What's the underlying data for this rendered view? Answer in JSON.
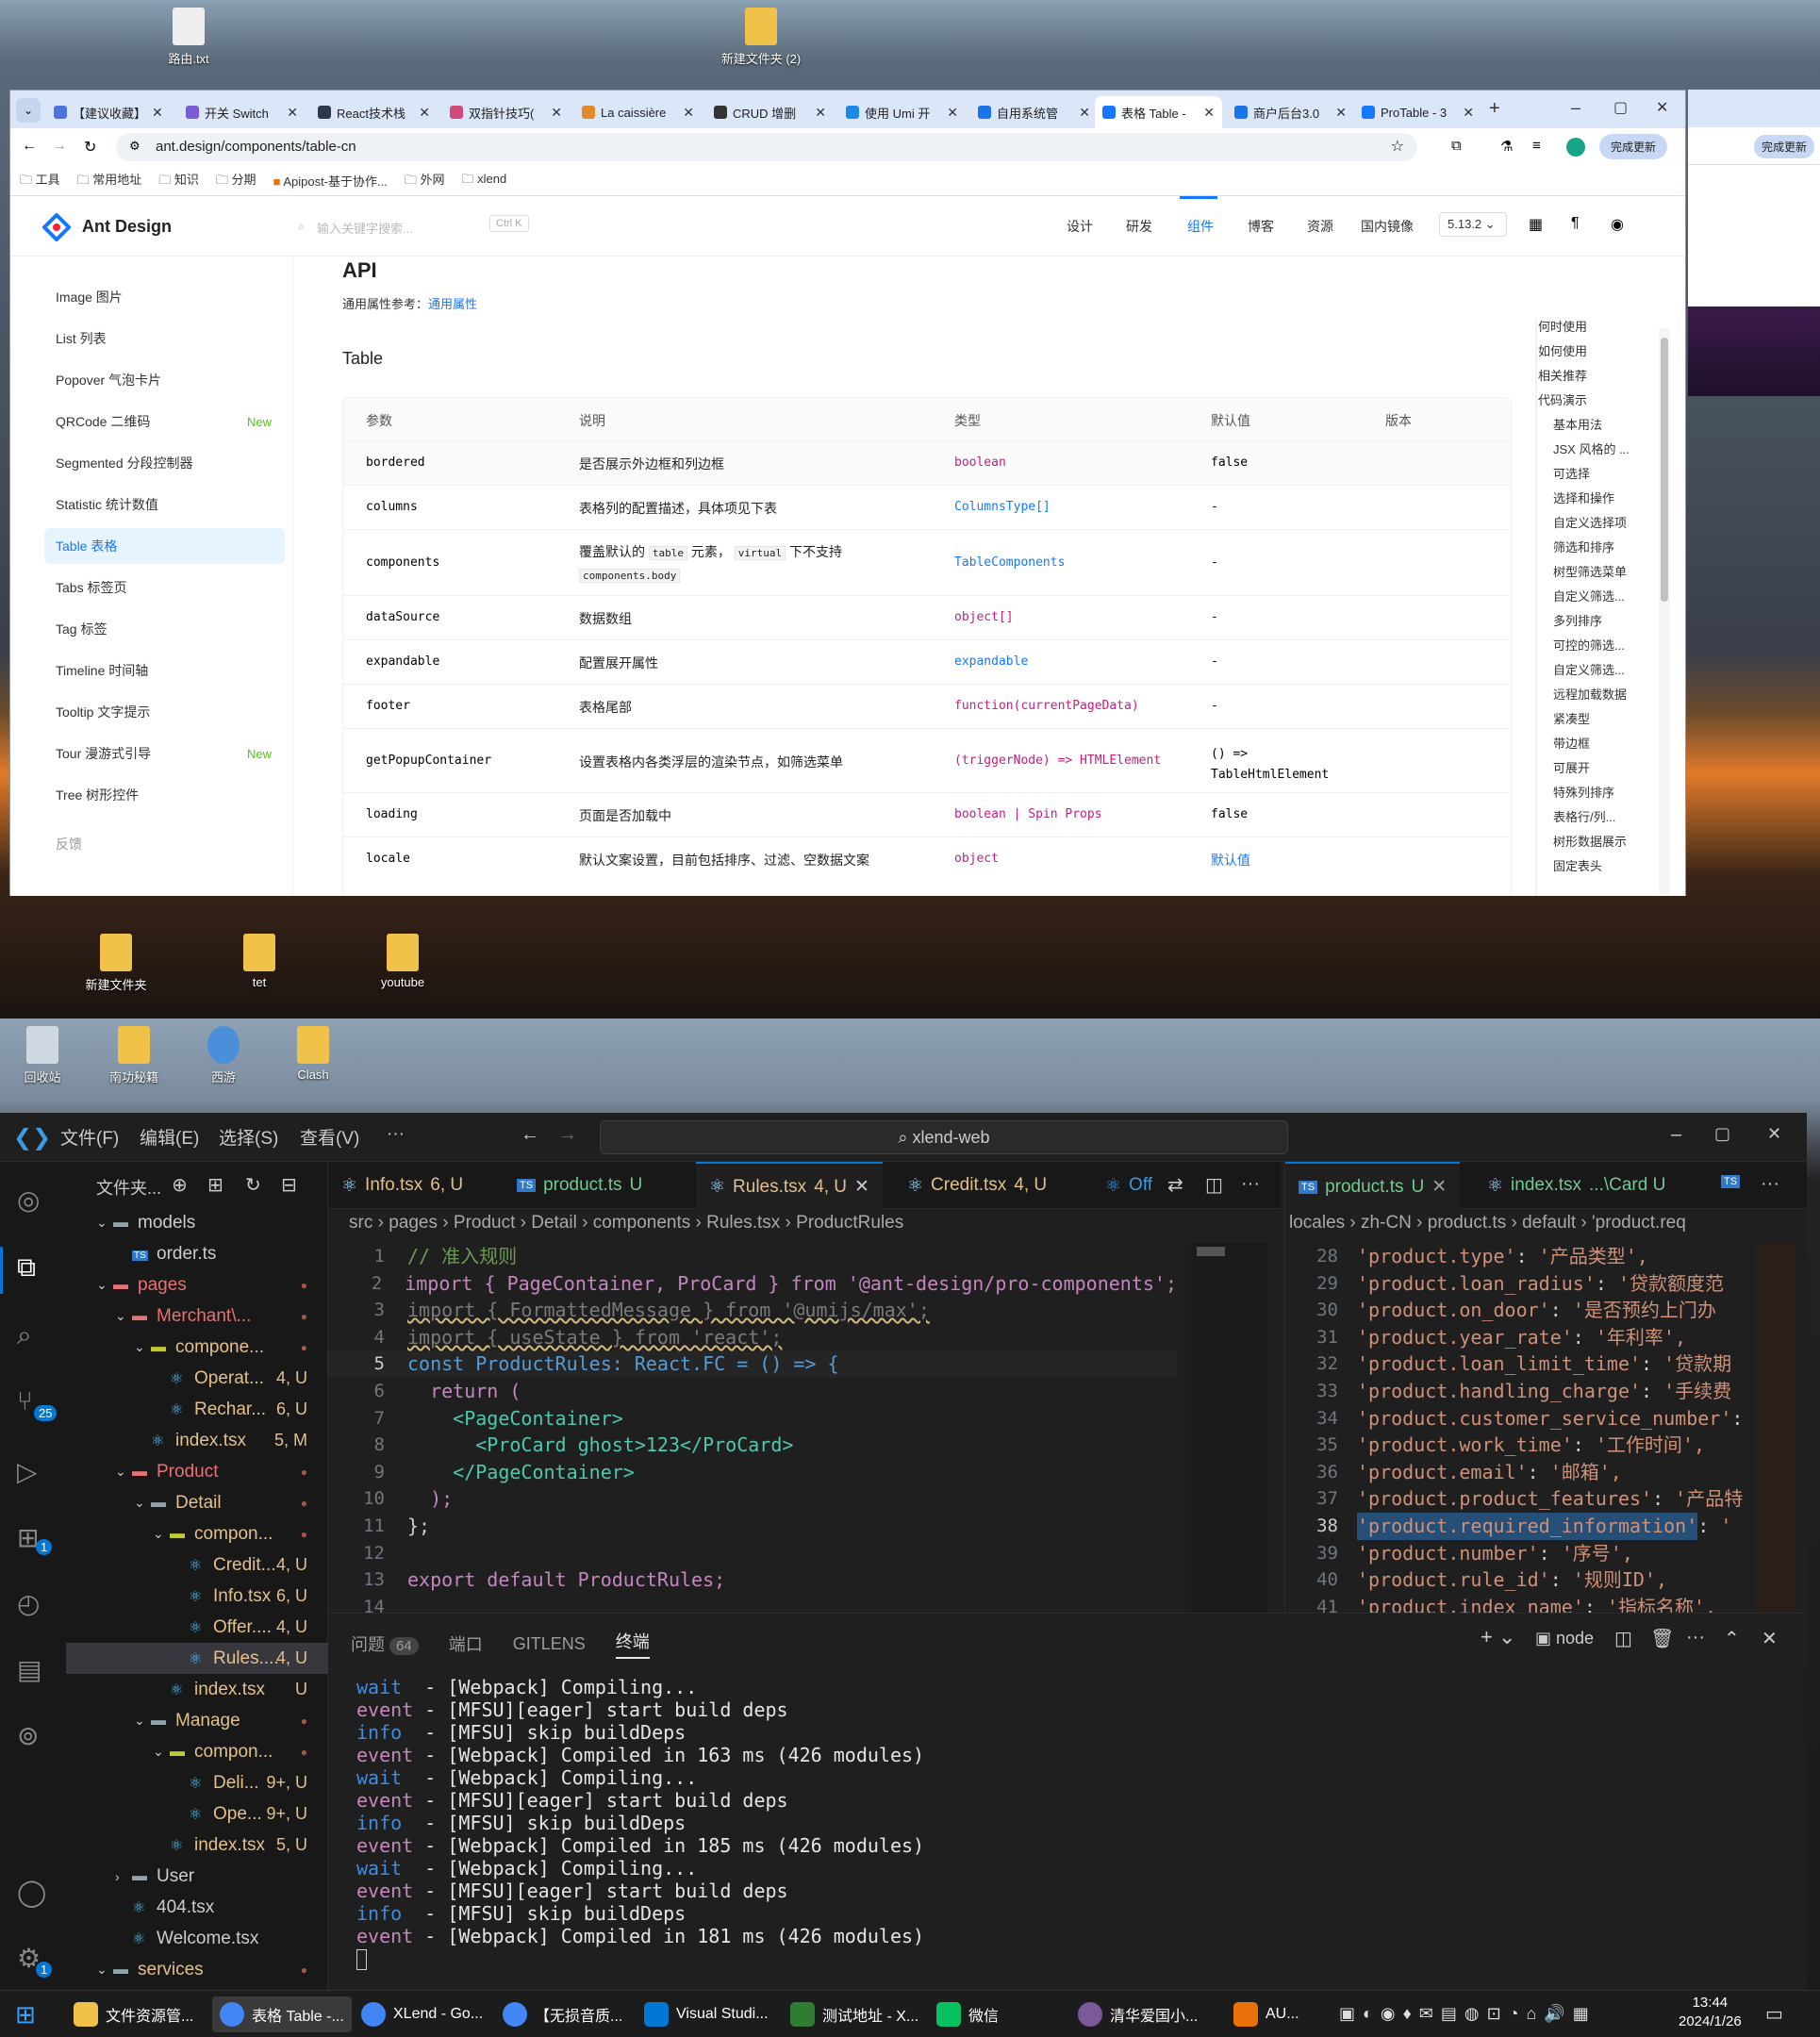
{
  "desktop_top": {
    "icons": [
      {
        "label": "路由.txt"
      },
      {
        "label": "新建文件夹 (2)"
      }
    ],
    "icons_lower": [
      {
        "label": "新建文件夹"
      },
      {
        "label": "tet"
      },
      {
        "label": "youtube"
      }
    ]
  },
  "desktop_bottom": {
    "icons": [
      {
        "label": "回收站"
      },
      {
        "label": "南功秘籍"
      },
      {
        "label": "西游"
      },
      {
        "label": "Clash"
      }
    ]
  },
  "browser": {
    "tabs": [
      {
        "label": "【建议收藏】"
      },
      {
        "label": "开关 Switch"
      },
      {
        "label": "React技术栈"
      },
      {
        "label": "双指针技巧("
      },
      {
        "label": "La caissière"
      },
      {
        "label": "CRUD 增删"
      },
      {
        "label": "使用 Umi 开"
      },
      {
        "label": "自用系统管"
      },
      {
        "label": "表格 Table -"
      },
      {
        "label": "商户后台3.0"
      },
      {
        "label": "ProTable - 3"
      }
    ],
    "url": "ant.design/components/table-cn",
    "update_button": "完成更新",
    "bookmarks": [
      "工具",
      "常用地址",
      "知识",
      "分期",
      "Apipost-基于协作...",
      "外网",
      "xlend"
    ]
  },
  "antd": {
    "logo": "Ant Design",
    "search_placeholder": "输入关键字搜索...",
    "search_shortcut": "Ctrl K",
    "nav": [
      "设计",
      "研发",
      "组件",
      "博客",
      "资源",
      "国内镜像"
    ],
    "version": "5.13.2",
    "sidebar": [
      {
        "label": "Image 图片"
      },
      {
        "label": "List 列表"
      },
      {
        "label": "Popover 气泡卡片"
      },
      {
        "label": "QRCode 二维码",
        "badge": "New"
      },
      {
        "label": "Segmented 分段控制器"
      },
      {
        "label": "Statistic 统计数值"
      },
      {
        "label": "Table 表格"
      },
      {
        "label": "Tabs 标签页"
      },
      {
        "label": "Tag 标签"
      },
      {
        "label": "Timeline 时间轴"
      },
      {
        "label": "Tooltip 文字提示"
      },
      {
        "label": "Tour 漫游式引导",
        "badge": "New"
      },
      {
        "label": "Tree 树形控件"
      },
      {
        "label": "反馈"
      }
    ],
    "api_title": "API",
    "common_props_label": "通用属性参考：",
    "common_props_link": "通用属性",
    "table_title": "Table",
    "columns": [
      "参数",
      "说明",
      "类型",
      "默认值",
      "版本"
    ],
    "rows": [
      {
        "param": "bordered",
        "desc": "是否展示外边框和列边框",
        "type": "boolean",
        "default": "false"
      },
      {
        "param": "columns",
        "desc": "表格列的配置描述，具体项见下表",
        "type": "ColumnsType[]",
        "default": "-"
      },
      {
        "param": "components",
        "desc": "覆盖默认的",
        "desc_code1": "table",
        "desc_mid": "元素，",
        "desc_code2": "virtual",
        "desc_tail": "下不支持",
        "desc_code3": "components.body",
        "type": "TableComponents",
        "default": "-"
      },
      {
        "param": "dataSource",
        "desc": "数据数组",
        "type": "object[]",
        "default": "-"
      },
      {
        "param": "expandable",
        "desc": "配置展开属性",
        "type": "expandable",
        "default": "-"
      },
      {
        "param": "footer",
        "desc": "表格尾部",
        "type": "function(currentPageData)",
        "default": "-"
      },
      {
        "param": "getPopupContainer",
        "desc": "设置表格内各类浮层的渲染节点，如筛选菜单",
        "type": "(triggerNode) => HTMLElement",
        "default": "() => TableHtmlElement"
      },
      {
        "param": "loading",
        "desc": "页面是否加载中",
        "type": "boolean | Spin Props",
        "default": "false"
      },
      {
        "param": "locale",
        "desc": "默认文案设置，目前包括排序、过滤、空数据文案",
        "type": "object",
        "default": "默认值"
      }
    ],
    "toc": [
      "何时使用",
      "如何使用",
      "相关推荐",
      "代码演示",
      "基本用法",
      "JSX 风格的 ...",
      "可选择",
      "选择和操作",
      "自定义选择项",
      "筛选和排序",
      "树型筛选菜单",
      "自定义筛选...",
      "多列排序",
      "可控的筛选...",
      "自定义筛选...",
      "远程加载数据",
      "紧凑型",
      "带边框",
      "可展开",
      "特殊列排序",
      "表格行/列...",
      "树形数据展示",
      "固定表头"
    ]
  },
  "vscode": {
    "menu": [
      "文件(F)",
      "编辑(E)",
      "选择(S)",
      "查看(V)",
      "···"
    ],
    "search": "xlend-web",
    "activity_badges": {
      "scm": "25",
      "ext": "1",
      "settings": "1"
    },
    "explorer_title": "文件夹...",
    "tree": [
      {
        "label": "models",
        "depth": 1,
        "kind": "folder",
        "open": true
      },
      {
        "label": "order.ts",
        "depth": 2,
        "kind": "ts"
      },
      {
        "label": "pages",
        "depth": 1,
        "kind": "folder-red",
        "open": true,
        "status": "●"
      },
      {
        "label": "Merchant\\...",
        "depth": 2,
        "kind": "folder-red",
        "open": true,
        "status": "●"
      },
      {
        "label": "compone...",
        "depth": 3,
        "kind": "folder-y",
        "open": true,
        "status": "●"
      },
      {
        "label": "Operat...",
        "depth": 4,
        "kind": "react",
        "status": "4, U"
      },
      {
        "label": "Rechar...",
        "depth": 4,
        "kind": "react",
        "status": "6, U"
      },
      {
        "label": "index.tsx",
        "depth": 3,
        "kind": "react",
        "status": "5, M"
      },
      {
        "label": "Product",
        "depth": 2,
        "kind": "folder-red",
        "open": true,
        "status": "●"
      },
      {
        "label": "Detail",
        "depth": 3,
        "kind": "folder",
        "open": true,
        "status": "●"
      },
      {
        "label": "compon...",
        "depth": 4,
        "kind": "folder-y",
        "open": true,
        "status": "●"
      },
      {
        "label": "Credit...",
        "depth": 5,
        "kind": "react",
        "status": "4, U"
      },
      {
        "label": "Info.tsx",
        "depth": 5,
        "kind": "react",
        "status": "6, U"
      },
      {
        "label": "Offer....",
        "depth": 5,
        "kind": "react",
        "status": "4, U"
      },
      {
        "label": "Rules....",
        "depth": 5,
        "kind": "react",
        "status": "4, U",
        "selected": true
      },
      {
        "label": "index.tsx",
        "depth": 4,
        "kind": "react",
        "status": "U"
      },
      {
        "label": "Manage",
        "depth": 3,
        "kind": "folder",
        "open": true,
        "status": "●"
      },
      {
        "label": "compon...",
        "depth": 4,
        "kind": "folder-y",
        "open": true,
        "status": "●"
      },
      {
        "label": "Deli...",
        "depth": 5,
        "kind": "react",
        "status": "9+, U"
      },
      {
        "label": "Ope...",
        "depth": 5,
        "kind": "react",
        "status": "9+, U"
      },
      {
        "label": "index.tsx",
        "depth": 4,
        "kind": "react",
        "status": "5, U"
      },
      {
        "label": "User",
        "depth": 2,
        "kind": "folder",
        "open": false
      },
      {
        "label": "404.tsx",
        "depth": 2,
        "kind": "react"
      },
      {
        "label": "Welcome.tsx",
        "depth": 2,
        "kind": "react"
      },
      {
        "label": "services",
        "depth": 1,
        "kind": "folder",
        "open": true,
        "status": "●"
      }
    ],
    "tabs": [
      {
        "label": "Info.tsx",
        "status": "6, U",
        "kind": "react"
      },
      {
        "label": "product.ts",
        "status": "U",
        "kind": "ts"
      },
      {
        "label": "Rules.tsx",
        "status": "4, U",
        "kind": "react",
        "active": true
      },
      {
        "label": "Credit.tsx",
        "status": "4, U",
        "kind": "react"
      }
    ],
    "tab_action_off": "Off",
    "breadcrumb": [
      "src",
      "pages",
      "Product",
      "Detail",
      "components",
      "Rules.tsx",
      "ProductRules"
    ],
    "code_lines": [
      {
        "n": "1",
        "t": "// 准入规则"
      },
      {
        "n": "2",
        "t": "import { PageContainer, ProCard } from '@ant-design/pro-components';"
      },
      {
        "n": "3",
        "t": "import { FormattedMessage } from '@umijs/max';"
      },
      {
        "n": "4",
        "t": "import { useState } from 'react';"
      },
      {
        "n": "5",
        "t": "const ProductRules: React.FC = () => {"
      },
      {
        "n": "6",
        "t": "  return ("
      },
      {
        "n": "7",
        "t": "    <PageContainer>"
      },
      {
        "n": "8",
        "t": "      <ProCard ghost>123</ProCard>"
      },
      {
        "n": "9",
        "t": "    </PageContainer>"
      },
      {
        "n": "10",
        "t": "  );"
      },
      {
        "n": "11",
        "t": "};"
      },
      {
        "n": "12",
        "t": ""
      },
      {
        "n": "13",
        "t": "export default ProductRules;"
      },
      {
        "n": "14",
        "t": ""
      }
    ],
    "tabs2": [
      {
        "label": "product.ts",
        "status": "U",
        "kind": "ts",
        "active": true
      },
      {
        "label": "index.tsx",
        "status": "...\\Card U",
        "kind": "react"
      }
    ],
    "breadcrumb2": [
      "locales",
      "zh-CN",
      "product.ts",
      "default",
      "'product.req"
    ],
    "code2": [
      {
        "n": "28",
        "k": "'product.type'",
        "v": "'产品类型',"
      },
      {
        "n": "29",
        "k": "'product.loan_radius'",
        "v": "'贷款额度范"
      },
      {
        "n": "30",
        "k": "'product.on_door'",
        "v": "'是否预约上门办"
      },
      {
        "n": "31",
        "k": "'product.year_rate'",
        "v": "'年利率',"
      },
      {
        "n": "32",
        "k": "'product.loan_limit_time'",
        "v": "'贷款期"
      },
      {
        "n": "33",
        "k": "'product.handling_charge'",
        "v": "'手续费"
      },
      {
        "n": "34",
        "k": "'product.customer_service_number'",
        "v": ""
      },
      {
        "n": "35",
        "k": "'product.work_time'",
        "v": "'工作时间',"
      },
      {
        "n": "36",
        "k": "'product.email'",
        "v": "'邮箱',"
      },
      {
        "n": "37",
        "k": "'product.product_features'",
        "v": "'产品特"
      },
      {
        "n": "38",
        "k": "'product.required_information'",
        "v": "'"
      },
      {
        "n": "39",
        "k": "'product.number'",
        "v": "'序号',"
      },
      {
        "n": "40",
        "k": "'product.rule_id'",
        "v": "'规则ID',"
      },
      {
        "n": "41",
        "k": "'product.index_name'",
        "v": "'指标名称',"
      }
    ],
    "panel_tabs": [
      "问题",
      "端口",
      "GITLENS",
      "终端"
    ],
    "problems_count": "64",
    "terminal_name": "node",
    "terminal": [
      {
        "lvl": "wait",
        "msg": "  - [Webpack] Compiling..."
      },
      {
        "lvl": "event",
        "msg": " - [MFSU][eager] start build deps"
      },
      {
        "lvl": "info",
        "msg": "  - [MFSU] skip buildDeps"
      },
      {
        "lvl": "event",
        "msg": " - [Webpack] Compiled in 163 ms (426 modules)"
      },
      {
        "lvl": "wait",
        "msg": "  - [Webpack] Compiling..."
      },
      {
        "lvl": "event",
        "msg": " - [MFSU][eager] start build deps"
      },
      {
        "lvl": "info",
        "msg": "  - [MFSU] skip buildDeps"
      },
      {
        "lvl": "event",
        "msg": " - [Webpack] Compiled in 185 ms (426 modules)"
      },
      {
        "lvl": "wait",
        "msg": "  - [Webpack] Compiling..."
      },
      {
        "lvl": "event",
        "msg": " - [MFSU][eager] start build deps"
      },
      {
        "lvl": "info",
        "msg": "  - [MFSU] skip buildDeps"
      },
      {
        "lvl": "event",
        "msg": " - [Webpack] Compiled in 181 ms (426 modules)"
      }
    ]
  },
  "taskbar": {
    "items": [
      {
        "label": "文件资源管..."
      },
      {
        "label": "表格 Table -..."
      },
      {
        "label": "XLend - Go..."
      },
      {
        "label": "【无损音质..."
      },
      {
        "label": "Visual Studi..."
      },
      {
        "label": "测试地址 - X..."
      },
      {
        "label": "微信"
      },
      {
        "label": "清华爱国小..."
      },
      {
        "label": "AU..."
      }
    ],
    "time": "13:44",
    "date": "2024/1/26"
  }
}
